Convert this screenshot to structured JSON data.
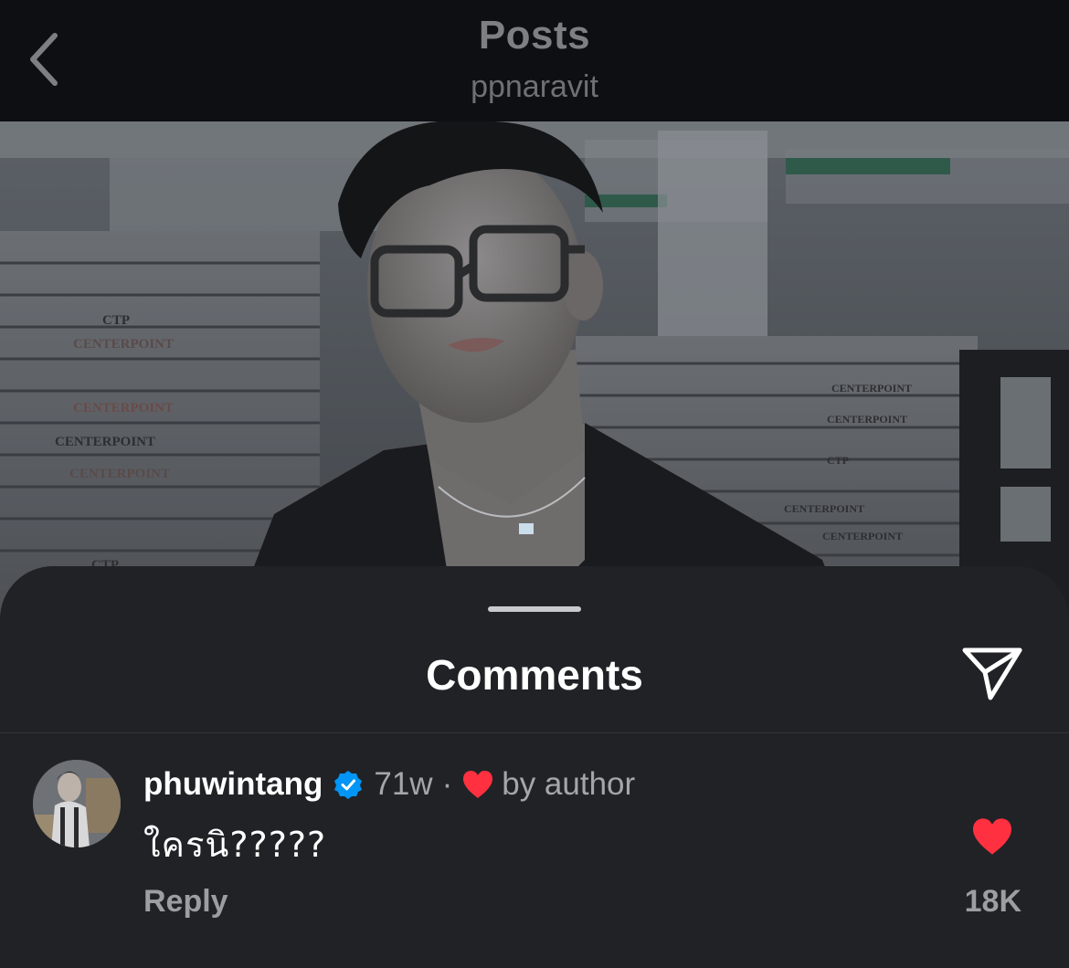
{
  "header": {
    "title": "Posts",
    "subtitle": "ppnaravit",
    "back_icon": "chevron-left-icon"
  },
  "photo": {
    "box_labels": [
      "CTP",
      "CENTERPOINT",
      "CENTERPOINT",
      "CENTERPOINT",
      "CENTERPOINT",
      "CTP",
      "CENTERPOINT",
      "CENTERPOINT",
      "CTP",
      "CENTERPOINT",
      "CENTERPOINT"
    ]
  },
  "comments_sheet": {
    "title": "Comments",
    "share_icon": "send-icon",
    "comment": {
      "username": "phuwintang",
      "verified_icon": "verified-badge-icon",
      "time": "71w",
      "separator": "·",
      "by_author_label": "by author",
      "text": "ใครนิ?????",
      "reply_label": "Reply",
      "like_count": "18K"
    }
  },
  "colors": {
    "background": "#0d0f12",
    "sheet": "#212226",
    "heart": "#ff3040",
    "verified": "#0095f6"
  }
}
